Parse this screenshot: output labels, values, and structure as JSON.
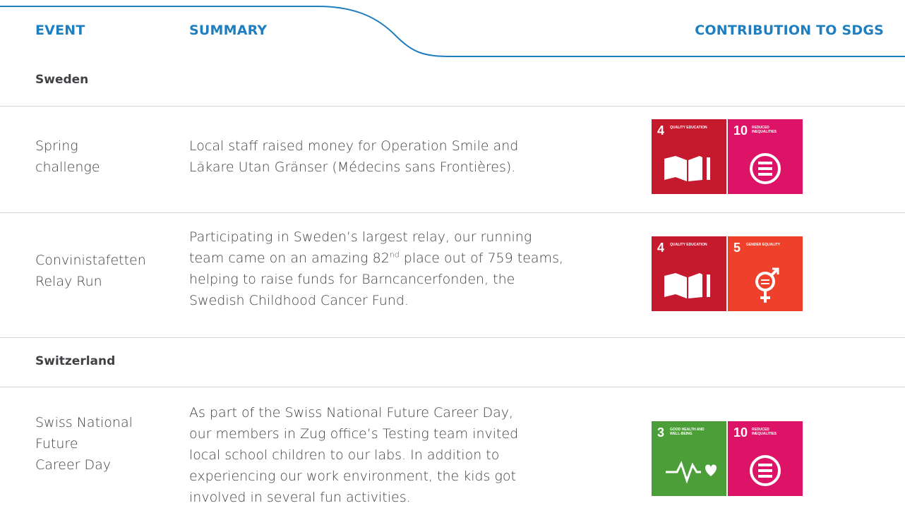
{
  "header": {
    "event": "EVENT",
    "summary": "SUMMARY",
    "contribution": "CONTRIBUTION TO SDGS"
  },
  "colors": {
    "accent": "#1e7ec0",
    "sdg4": "#c5192d",
    "sdg10": "#dd1367",
    "sdg5": "#ef402b",
    "sdg3": "#4c9f38"
  },
  "sections": [
    {
      "name": "Sweden",
      "rows": [
        {
          "event_lines": [
            "Spring",
            "challenge"
          ],
          "summary_lines": [
            "Local staff raised money for Operation Smile and",
            "Läkare Utan Gränser (Médecins sans Frontières)."
          ],
          "sdgs": [
            {
              "number": "4",
              "text": "QUALITY EDUCATION",
              "icon": "book-pencil-icon"
            },
            {
              "number": "10",
              "text": "REDUCED INEQUALITIES",
              "icon": "equals-circle-icon"
            }
          ]
        },
        {
          "event_lines": [
            "Convinistafetten",
            "Relay Run"
          ],
          "summary_lines": [
            "Participating in Sweden’s largest relay, our running",
            "team came on an amazing 82",
            "nd",
            " place out of 759 teams,",
            "helping to raise funds for Barncancerfonden, the",
            "Swedish Childhood Cancer Fund."
          ],
          "sdgs": [
            {
              "number": "4",
              "text": "QUALITY EDUCATION",
              "icon": "book-pencil-icon"
            },
            {
              "number": "5",
              "text": "GENDER EQUALITY",
              "icon": "gender-equality-icon"
            }
          ]
        }
      ]
    },
    {
      "name": "Switzerland",
      "rows": [
        {
          "event_lines": [
            "Swiss National",
            "Future",
            "Career Day"
          ],
          "summary_lines": [
            "As part of the Swiss National Future Career Day,",
            "our members in Zug office’s Testing team invited",
            "local school children to our labs. In addition to",
            "experiencing our work environment, the kids got",
            "involved in several fun activities."
          ],
          "sdgs": [
            {
              "number": "3",
              "text": "GOOD HEALTH AND WELL-BEING",
              "icon": "heartbeat-icon"
            },
            {
              "number": "10",
              "text": "REDUCED INEQUALITIES",
              "icon": "equals-circle-icon"
            }
          ]
        }
      ]
    }
  ]
}
